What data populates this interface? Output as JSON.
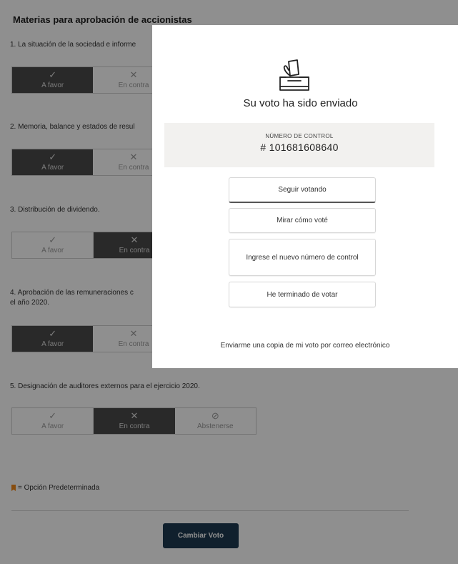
{
  "page": {
    "section_title": "Materias para aprobación de accionistas",
    "questions": [
      {
        "text": "1. La situación de la sociedad e informe",
        "selected": "A favor"
      },
      {
        "text": "2. Memoria, balance y estados de resul",
        "selected": "A favor"
      },
      {
        "text": "3. Distribución de dividendo.",
        "selected": "En contra"
      },
      {
        "text": "4. Aprobación de las remuneraciones c\nel año 2020.",
        "selected": "A favor"
      },
      {
        "text": "5. Designación de auditores externos para el ejercicio 2020.",
        "selected": "En contra"
      }
    ],
    "options": {
      "favor": "A favor",
      "contra": "En contra",
      "abstain": "Abstenerse"
    },
    "legend_text": "= Opción Predeterminada",
    "change_vote_label": "Cambiar Voto"
  },
  "modal": {
    "title": "Su voto ha sido enviado",
    "control_label": "NÚMERO DE CONTROL",
    "control_number": "# 101681608640",
    "buttons": {
      "keep_voting": "Seguir votando",
      "see_vote": "Mirar cómo voté",
      "new_control": "Ingrese el nuevo número de control",
      "done": "He terminado de votar"
    },
    "email_link": "Enviarme una copia de mi voto por correo electrónico"
  },
  "colors": {
    "selected_option": "#4a4a4a",
    "primary_button": "#1d3a50",
    "legend_flag": "#f08a1c",
    "overlay": "rgba(0,0,0,0.44)"
  },
  "icons": {
    "check": "check-icon",
    "cross": "cross-icon",
    "abstain": "abstain-icon",
    "ballot": "ballot-box-icon",
    "flag": "bookmark-flag-icon"
  }
}
